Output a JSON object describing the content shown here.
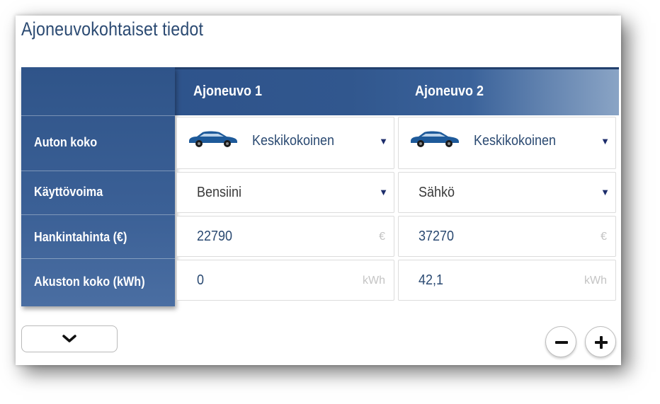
{
  "title": "Ajoneuvokohtaiset tiedot",
  "columns": [
    "Ajoneuvo 1",
    "Ajoneuvo 2"
  ],
  "rows": {
    "size": {
      "label": "Auton koko",
      "values": [
        "Keskikokoinen",
        "Keskikokoinen"
      ]
    },
    "fuel": {
      "label": "Käyttövoima",
      "values": [
        "Bensiini",
        "Sähkö"
      ]
    },
    "price": {
      "label": "Hankintahinta (€)",
      "values": [
        "22790",
        "37270"
      ],
      "unit": "€"
    },
    "battery": {
      "label": "Akuston koko (kWh)",
      "values": [
        "0",
        "42,1"
      ],
      "unit": "kWh"
    }
  },
  "icons": {
    "car": "car-icon",
    "dropdown": "caret-down-icon",
    "expand": "chevron-down-icon",
    "remove": "minus-icon",
    "add": "plus-icon"
  },
  "colors": {
    "header": "#2c5089",
    "title": "#2b4a72",
    "accent_dark": "#1d2d6b"
  }
}
